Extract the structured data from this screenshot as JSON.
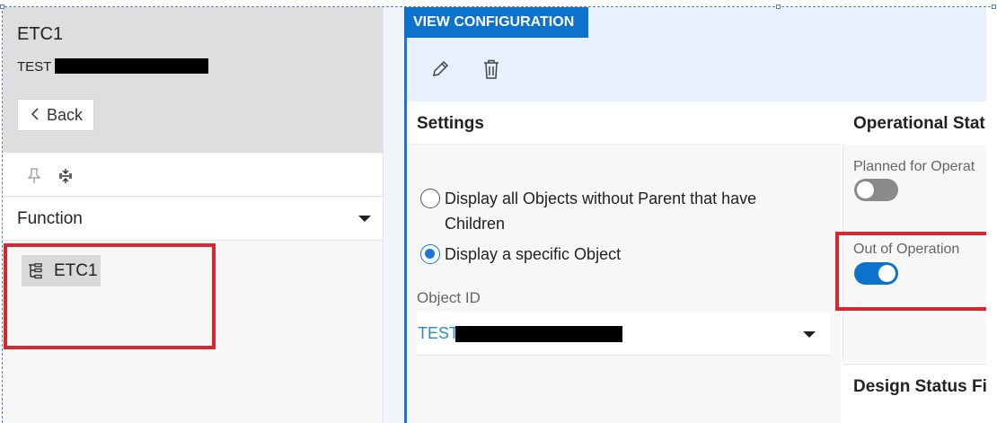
{
  "left_panel": {
    "title": "ETC1",
    "subtitle": "TEST",
    "back_label": "Back",
    "function_dropdown": "Function",
    "tree_items": [
      {
        "label": "ETC1"
      }
    ]
  },
  "right_panel": {
    "tab_label": "VIEW CONFIGURATION",
    "settings": {
      "title": "Settings",
      "radio_all_line1": "Display all Objects without Parent that have",
      "radio_all_line2": "Children",
      "radio_specific": "Display a specific Object",
      "object_id_label": "Object ID",
      "object_id_value": "TEST"
    },
    "operational_status": {
      "title": "Operational Stat",
      "planned_label": "Planned for Operat",
      "planned_on": false,
      "out_label": "Out of Operation",
      "out_on": true
    },
    "design_status": {
      "title": "Design Status Fi"
    }
  },
  "colors": {
    "accent": "#0d72cc",
    "highlight": "#d62831"
  },
  "icons": [
    "pencil-icon",
    "trash-icon",
    "pin-icon",
    "collapse-icon",
    "tree-icon",
    "chevron-left-icon",
    "caret-down-icon"
  ]
}
